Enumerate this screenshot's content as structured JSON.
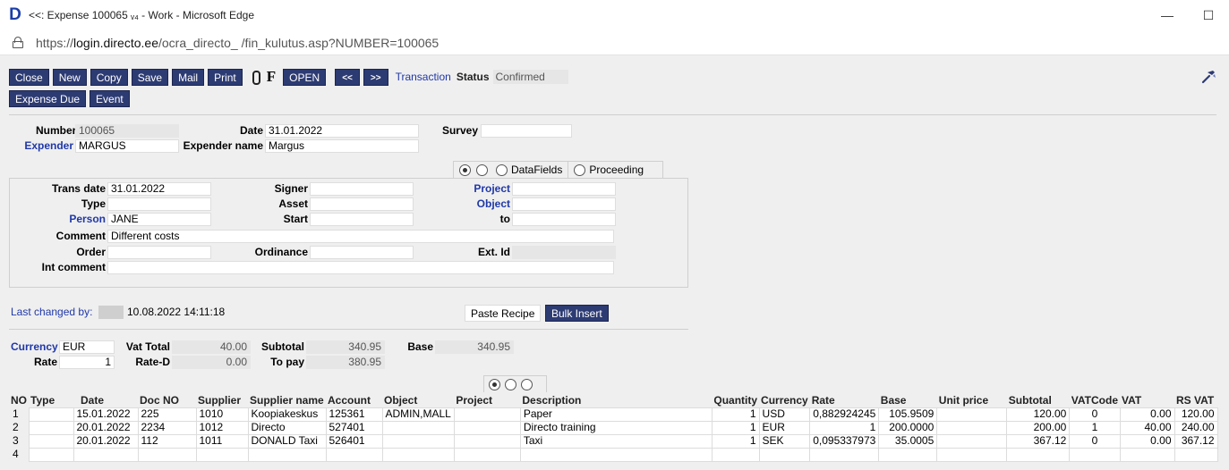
{
  "window": {
    "logo": "D",
    "title": "<<: Expense 100065 ᵥ₄ - Work - Microsoft Edge",
    "minimize": "—",
    "maximize": "☐"
  },
  "address": {
    "prefix": "https://",
    "host": "login.directo.ee",
    "path": "/ocra_directo_      /fin_kulutus.asp?NUMBER=100065"
  },
  "toolbar": {
    "close": "Close",
    "new": "New",
    "copy": "Copy",
    "save": "Save",
    "mail": "Mail",
    "print": "Print",
    "f": "F",
    "open": "OPEN",
    "prev": "<<",
    "next": ">>",
    "transaction": "Transaction",
    "status_label": "Status",
    "status_value": "Confirmed",
    "expense_due": "Expense Due",
    "event": "Event"
  },
  "header": {
    "number_label": "Number",
    "number": "100065",
    "date_label": "Date",
    "date": "31.01.2022",
    "survey_label": "Survey",
    "survey": "",
    "expender_label": "Expender",
    "expender": "MARGUS",
    "expender_name_label": "Expender name",
    "expender_name": "Margus"
  },
  "tabs": {
    "datafields": "DataFields",
    "proceeding": "Proceeding"
  },
  "details": {
    "trans_date_label": "Trans date",
    "trans_date": "31.01.2022",
    "signer_label": "Signer",
    "signer": "",
    "project_label": "Project",
    "project": "",
    "type_label": "Type",
    "type": "",
    "asset_label": "Asset",
    "asset": "",
    "object_label": "Object",
    "object": "",
    "person_label": "Person",
    "person": "JANE",
    "start_label": "Start",
    "start": "",
    "to_label": "to",
    "to": "",
    "comment_label": "Comment",
    "comment": "Different costs",
    "order_label": "Order",
    "order": "",
    "ordinance_label": "Ordinance",
    "ordinance": "",
    "ext_id_label": "Ext. Id",
    "ext_id": "",
    "int_comment_label": "Int comment",
    "int_comment": ""
  },
  "meta": {
    "last_changed_label": "Last changed by:",
    "last_changed_when": "10.08.2022 14:11:18",
    "paste_recipe": "Paste Recipe",
    "bulk_insert": "Bulk Insert"
  },
  "totals": {
    "currency_label": "Currency",
    "currency": "EUR",
    "vat_total_label": "Vat Total",
    "vat_total": "40.00",
    "subtotal_label": "Subtotal",
    "subtotal": "340.95",
    "base_label": "Base",
    "base": "340.95",
    "rate_label": "Rate",
    "rate": "1",
    "rate_d_label": "Rate-D",
    "rate_d": "0.00",
    "to_pay_label": "To pay",
    "to_pay": "380.95"
  },
  "grid": {
    "columns": [
      "NO",
      "Type",
      "Date",
      "Doc NO",
      "Supplier",
      "Supplier name",
      "Account",
      "Object",
      "Project",
      "Description",
      "Quantity",
      "Currency",
      "Rate",
      "Base",
      "Unit price",
      "Subtotal",
      "VATCode",
      "VAT",
      "RS VAT"
    ],
    "rows": [
      {
        "no": "1",
        "type": "",
        "date": "15.01.2022",
        "doc": "225",
        "supplier": "1010",
        "supplier_name": "Koopiakeskus",
        "account": "125361",
        "object": "ADMIN,MALL",
        "project": "",
        "description": "Paper",
        "quantity": "1",
        "currency": "USD",
        "rate": "0,882924245",
        "base": "105.9509",
        "unit_price": "",
        "subtotal": "120.00",
        "vatcode": "0",
        "vat": "0.00",
        "rs_vat": "120.00"
      },
      {
        "no": "2",
        "type": "",
        "date": "20.01.2022",
        "doc": "2234",
        "supplier": "1012",
        "supplier_name": "Directo",
        "account": "527401",
        "object": "",
        "project": "",
        "description": "Directo training",
        "quantity": "1",
        "currency": "EUR",
        "rate": "1",
        "base": "200.0000",
        "unit_price": "",
        "subtotal": "200.00",
        "vatcode": "1",
        "vat": "40.00",
        "rs_vat": "240.00"
      },
      {
        "no": "3",
        "type": "",
        "date": "20.01.2022",
        "doc": "112",
        "supplier": "1011",
        "supplier_name": "DONALD Taxi",
        "account": "526401",
        "object": "",
        "project": "",
        "description": "Taxi",
        "quantity": "1",
        "currency": "SEK",
        "rate": "0,095337973",
        "base": "35.0005",
        "unit_price": "",
        "subtotal": "367.12",
        "vatcode": "0",
        "vat": "0.00",
        "rs_vat": "367.12"
      },
      {
        "no": "4",
        "type": "",
        "date": "",
        "doc": "",
        "supplier": "",
        "supplier_name": "",
        "account": "",
        "object": "",
        "project": "",
        "description": "",
        "quantity": "",
        "currency": "",
        "rate": "",
        "base": "",
        "unit_price": "",
        "subtotal": "",
        "vatcode": "",
        "vat": "",
        "rs_vat": ""
      }
    ]
  }
}
